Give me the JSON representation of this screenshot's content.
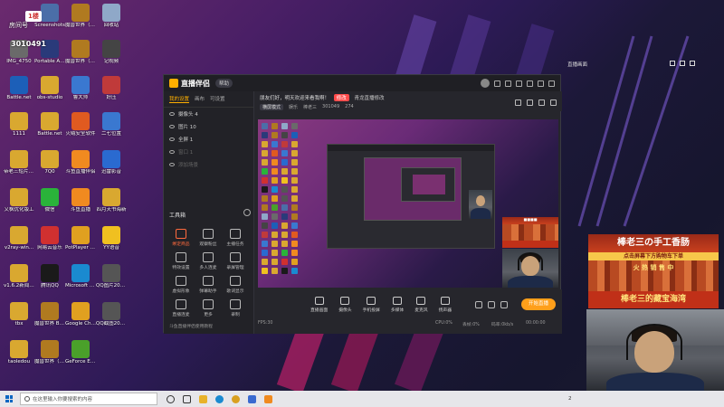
{
  "desktop": {
    "room_label": "房间号",
    "room_id": "3010491",
    "badge": "1楼",
    "icons": [
      {
        "label": "Screenshots",
        "color": "#4b6ea8"
      },
      {
        "label": "魔兽世界（经典怀旧服）",
        "color": "#b07a20"
      },
      {
        "label": "回收站",
        "color": "#8fa8c8"
      },
      {
        "label": "IMG_4750",
        "color": "#6a6a6a"
      },
      {
        "label": "Portable Adobe P...",
        "color": "#2a3a7a"
      },
      {
        "label": "魔兽世界（经典怀旧服）",
        "color": "#b07a20"
      },
      {
        "label": "记视频",
        "color": "#444"
      },
      {
        "label": "Battle.net",
        "color": "#1c5fb8"
      },
      {
        "label": "obs-studio",
        "color": "#d9a830"
      },
      {
        "label": "鲁大师",
        "color": "#3a78d0"
      },
      {
        "label": "好压",
        "color": "#c03a3a"
      },
      {
        "label": "1111",
        "color": "#d9a830"
      },
      {
        "label": "Battle.net",
        "color": "#d9a830"
      },
      {
        "label": "火绒安全软件",
        "color": "#e05a20"
      },
      {
        "label": "二七位置",
        "color": "#3a78d0"
      },
      {
        "label": "帝老三短片1.27",
        "color": "#d9a830"
      },
      {
        "label": "7Q0",
        "color": "#d9a830"
      },
      {
        "label": "斗鱼直播伴侣",
        "color": "#f08a20"
      },
      {
        "label": "迅雷影音",
        "color": "#2a6ad0"
      },
      {
        "label": "又枫优化版工",
        "color": "#d9a830"
      },
      {
        "label": "微信",
        "color": "#2ab33a"
      },
      {
        "label": "斗鱼直播",
        "color": "#f08a20"
      },
      {
        "label": "四月天书海新",
        "color": "#d9a830"
      },
      {
        "label": "v2ray-win...",
        "color": "#d9a830"
      },
      {
        "label": "网易云音乐",
        "color": "#d03030"
      },
      {
        "label": "PotPlayer 64 bit",
        "color": "#e0a020"
      },
      {
        "label": "YY语音",
        "color": "#f0c020"
      },
      {
        "label": "v1.6.2新闻采集器",
        "color": "#d9a830"
      },
      {
        "label": "腾讯QQ",
        "color": "#1a1a1a"
      },
      {
        "label": "Microsoft Edge",
        "color": "#1a8ad0"
      },
      {
        "label": "QQ图片20200509...",
        "color": "#555"
      },
      {
        "label": "tbx",
        "color": "#d9a830"
      },
      {
        "label": "魔兽世界 Beta测试",
        "color": "#b07a20"
      },
      {
        "label": "Google Chrome",
        "color": "#e0a020"
      },
      {
        "label": "QQ截图20200514...",
        "color": "#555"
      },
      {
        "label": "taoledou",
        "color": "#d9a830"
      },
      {
        "label": "魔兽世界（经典怀旧服）",
        "color": "#b07a20"
      },
      {
        "label": "GeForce Experience",
        "color": "#4aa02a"
      }
    ]
  },
  "app": {
    "name": "直播伴侣",
    "pill": "帮助",
    "source_tabs": [
      "我的设置",
      "画布",
      "可设置"
    ],
    "sources": [
      {
        "label": "摄像头 4"
      },
      {
        "label": "图片 10"
      },
      {
        "label": "全屏 1"
      },
      {
        "label": "窗口 1"
      },
      {
        "label": "添加场景"
      }
    ],
    "tools_title": "工具箱",
    "tools": [
      {
        "label": "绑定商品",
        "accent": true
      },
      {
        "label": "观察粉丝",
        "accent": false
      },
      {
        "label": "主播任务",
        "accent": false
      },
      {
        "label": "特效设置",
        "accent": false
      },
      {
        "label": "多人连麦",
        "accent": false
      },
      {
        "label": "录屏管理",
        "accent": false
      },
      {
        "label": "虚拟形象",
        "accent": false
      },
      {
        "label": "弹幕助手",
        "accent": false
      },
      {
        "label": "歌词显示",
        "accent": false
      },
      {
        "label": "直播连麦",
        "accent": false
      },
      {
        "label": "更多",
        "accent": false
      },
      {
        "label": "录制",
        "accent": false
      }
    ],
    "left_footer": "斗鱼直播伴侣使用教程",
    "announcement": "朋友们好，明天欢迎来看我啊！",
    "announce_btn": "修改",
    "announce_sub": "青龙直播修改",
    "mode": "横屏模式",
    "mode_label": "娱乐",
    "game": "棒老三",
    "room_number": "301049",
    "viewers": "274",
    "controls": [
      {
        "label": "直播画面"
      },
      {
        "label": "摄像头"
      },
      {
        "label": "手机投屏"
      },
      {
        "label": "多媒体"
      },
      {
        "label": "麦克风"
      },
      {
        "label": "扬声器"
      }
    ],
    "live_btn": "开始直播",
    "status": {
      "fps": "FPS:30",
      "cpu": "CPU:0%",
      "drop": "丢帧:0%",
      "rate": "码率:0kb/s",
      "time": "00:00:00"
    }
  },
  "overlay": {
    "title": "直播画面",
    "ad_top": "棒老三の手工香肠",
    "ad_yellow": "点击屏幕下方购物车下单",
    "ad_tag": "火 热 销 售 中",
    "ad_bottom": "棒老三的藏宝海湾"
  },
  "taskbar": {
    "search_placeholder": "在这里输入你要搜索的内容",
    "clock": "2"
  }
}
